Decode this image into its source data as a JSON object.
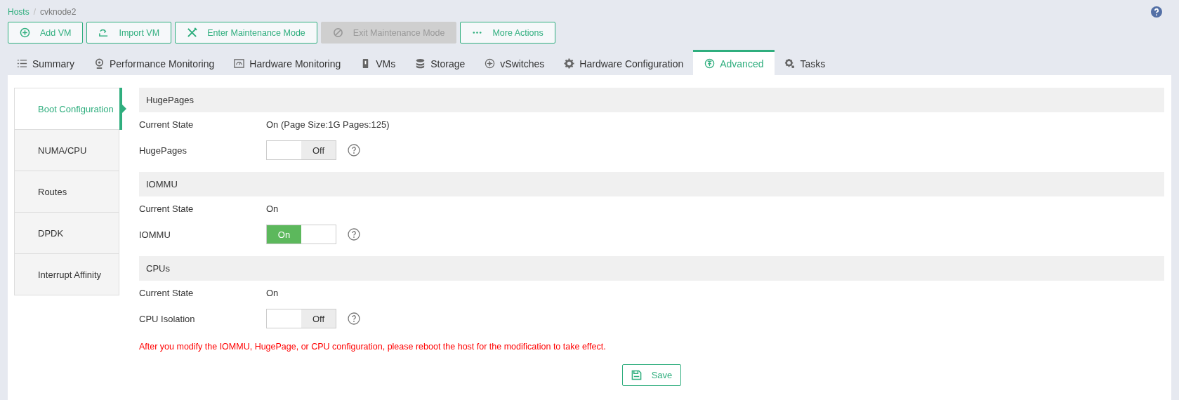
{
  "breadcrumb": {
    "parent": "Hosts",
    "separator": "/",
    "current": "cvknode2"
  },
  "actions": [
    {
      "label": "Add VM",
      "disabled": false
    },
    {
      "label": "Import VM",
      "disabled": false
    },
    {
      "label": "Enter Maintenance Mode",
      "disabled": false
    },
    {
      "label": "Exit Maintenance Mode",
      "disabled": true
    },
    {
      "label": "More Actions",
      "disabled": false
    }
  ],
  "tabs": [
    {
      "label": "Summary",
      "selected": false
    },
    {
      "label": "Performance Monitoring",
      "selected": false
    },
    {
      "label": "Hardware Monitoring",
      "selected": false
    },
    {
      "label": "VMs",
      "selected": false
    },
    {
      "label": "Storage",
      "selected": false
    },
    {
      "label": "vSwitches",
      "selected": false
    },
    {
      "label": "Hardware Configuration",
      "selected": false
    },
    {
      "label": "Advanced",
      "selected": true
    },
    {
      "label": "Tasks",
      "selected": false
    }
  ],
  "side_menu": [
    {
      "label": "Boot Configuration",
      "selected": true
    },
    {
      "label": "NUMA/CPU",
      "selected": false
    },
    {
      "label": "Routes",
      "selected": false
    },
    {
      "label": "DPDK",
      "selected": false
    },
    {
      "label": "Interrupt Affinity",
      "selected": false
    }
  ],
  "sections": [
    {
      "title": "HugePages",
      "state_label": "Current State",
      "state_value": "On (Page Size:1G Pages:125)",
      "toggle_label": "HugePages",
      "toggle_text": "Off",
      "on": false
    },
    {
      "title": "IOMMU",
      "state_label": "Current State",
      "state_value": "On",
      "toggle_label": "IOMMU",
      "toggle_text": "On",
      "on": true
    },
    {
      "title": "CPUs",
      "state_label": "Current State",
      "state_value": "On",
      "toggle_label": "CPU Isolation",
      "toggle_text": "Off",
      "on": false
    }
  ],
  "warning": "After you modify the IOMMU, HugePage, or CPU configuration, please reboot the host for the modification to take effect.",
  "save_label": "Save"
}
